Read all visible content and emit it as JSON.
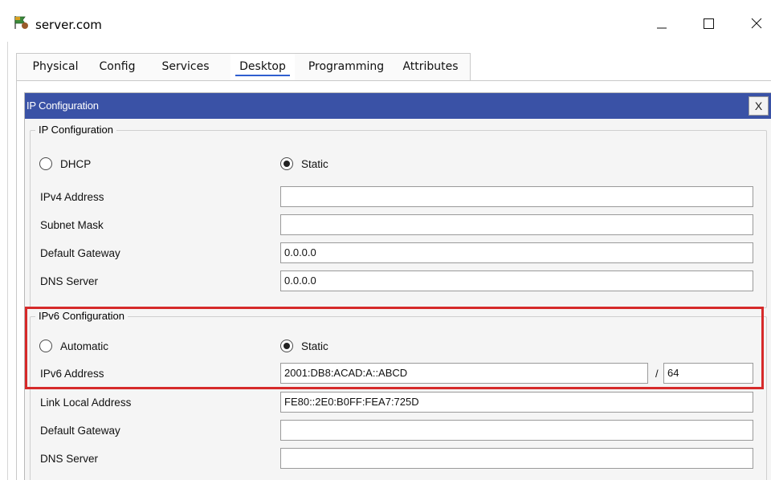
{
  "window": {
    "title": "server.com"
  },
  "tabs": [
    {
      "label": "Physical"
    },
    {
      "label": "Config"
    },
    {
      "label": "Services"
    },
    {
      "label": "Desktop",
      "active": true
    },
    {
      "label": "Programming"
    },
    {
      "label": "Attributes"
    }
  ],
  "panel": {
    "title": "IP Configuration",
    "close_label": "X"
  },
  "ipv4": {
    "group_title": "IP Configuration",
    "mode_options": [
      "DHCP",
      "Static"
    ],
    "selected_mode": "Static",
    "fields": [
      {
        "label": "IPv4 Address",
        "value": ""
      },
      {
        "label": "Subnet Mask",
        "value": ""
      },
      {
        "label": "Default Gateway",
        "value": "0.0.0.0"
      },
      {
        "label": "DNS Server",
        "value": "0.0.0.0"
      }
    ]
  },
  "ipv6": {
    "group_title": "IPv6 Configuration",
    "mode_options": [
      "Automatic",
      "Static"
    ],
    "selected_mode": "Static",
    "address_label": "IPv6 Address",
    "address_value": "2001:DB8:ACAD:A::ABCD",
    "prefix_separator": "/",
    "prefix_value": "64",
    "fields": [
      {
        "label": "Link Local Address",
        "value": "FE80::2E0:B0FF:FEA7:725D"
      },
      {
        "label": "Default Gateway",
        "value": ""
      },
      {
        "label": "DNS Server",
        "value": ""
      }
    ]
  },
  "colors": {
    "header_bar": "#3a52a6",
    "highlight": "#d62a2a",
    "active_tab_underline": "#2f5fd0"
  }
}
